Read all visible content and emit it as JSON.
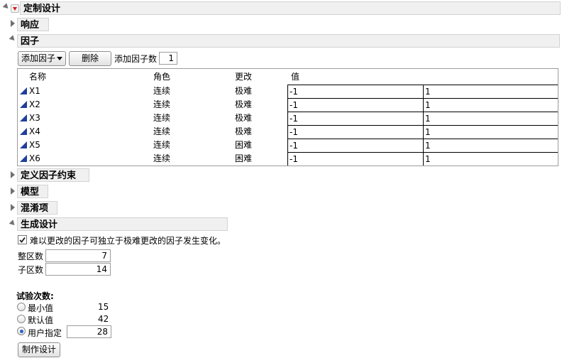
{
  "title": "定制设计",
  "sections": {
    "response": "响应",
    "factors": "因子",
    "constraints": "定义因子约束",
    "model": "模型",
    "alias": "混淆项",
    "generate": "生成设计"
  },
  "factors_toolbar": {
    "add_factor": "添加因子",
    "remove": "删除",
    "add_n_label": "添加因子数",
    "add_n_value": "1"
  },
  "factor_table": {
    "headers": {
      "name": "名称",
      "role": "角色",
      "change": "更改",
      "values": "值"
    },
    "rows": [
      {
        "name": "X1",
        "role": "连续",
        "change": "极难",
        "low": "-1",
        "high": "1"
      },
      {
        "name": "X2",
        "role": "连续",
        "change": "极难",
        "low": "-1",
        "high": "1"
      },
      {
        "name": "X3",
        "role": "连续",
        "change": "极难",
        "low": "-1",
        "high": "1"
      },
      {
        "name": "X4",
        "role": "连续",
        "change": "极难",
        "low": "-1",
        "high": "1"
      },
      {
        "name": "X5",
        "role": "连续",
        "change": "困难",
        "low": "-1",
        "high": "1"
      },
      {
        "name": "X6",
        "role": "连续",
        "change": "困难",
        "low": "-1",
        "high": "1"
      }
    ]
  },
  "generate": {
    "checkbox_label": "难以更改的因子可独立于极难更改的因子发生变化。",
    "whole_plots_label": "整区数",
    "whole_plots_value": "7",
    "subplots_label": "子区数",
    "subplots_value": "14",
    "runs_label": "试验次数:",
    "min_label": "最小值",
    "min_value": "15",
    "default_label": "默认值",
    "default_value": "42",
    "user_label": "用户指定",
    "user_value": "28",
    "make_button": "制作设计"
  },
  "colors": {
    "red_triangle": "#d21b1b",
    "factor_icon": "#1f3f9a",
    "header_bg": "#f0f0f0"
  }
}
